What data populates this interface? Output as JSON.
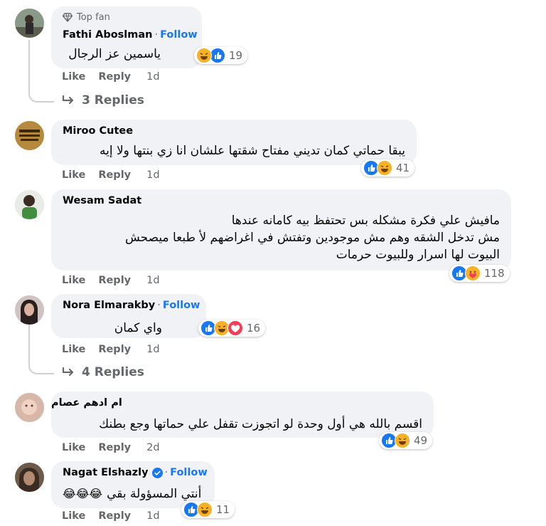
{
  "comments": [
    {
      "badge": "Top fan",
      "author": "Fathi Aboslman",
      "follow": "Follow",
      "text": "ياسمين عز الرجال",
      "reactions": [
        "haha",
        "like"
      ],
      "count": "19",
      "like": "Like",
      "reply": "Reply",
      "time": "1d",
      "replies": "3 Replies"
    },
    {
      "author": "Miroo Cutee",
      "text": "يبقا حماتي كمان تديني مفتاح شقتها علشان انا زي بنتها ولا إيه",
      "reactions": [
        "like",
        "haha"
      ],
      "count": "41",
      "like": "Like",
      "reply": "Reply",
      "time": "1d"
    },
    {
      "author": "Wesam Sadat",
      "lines": [
        "مافيش علي فكرة مشكله بس تحتفظ بيه كامانه عندها",
        "مش تدخل الشقه وهم مش موجودين وتفتش في اغراضهم لأ طبعا ميصحش",
        "البيوت لها اسرار وللبيوت حرمات"
      ],
      "reactions": [
        "like",
        "care"
      ],
      "count": "118",
      "like": "Like",
      "reply": "Reply",
      "time": "1d"
    },
    {
      "author": "Nora Elmarakby",
      "follow": "Follow",
      "text": "واي كمان",
      "reactions": [
        "like",
        "haha",
        "love"
      ],
      "count": "16",
      "like": "Like",
      "reply": "Reply",
      "time": "1d",
      "replies": "4 Replies"
    },
    {
      "author": "ام ادهم عصام",
      "text": "اقسم بالله هي أول وحدة لو اتجوزت تقفل علي حماتها وجع بطنك",
      "reactions": [
        "like",
        "haha"
      ],
      "count": "49",
      "like": "Like",
      "reply": "Reply",
      "time": "2d"
    },
    {
      "author": "Nagat Elshazly",
      "follow": "Follow",
      "text": "أنتي المسؤولة بقي",
      "emoji_glyphs": "😂😂😂",
      "reactions": [
        "like",
        "haha"
      ],
      "count": "11",
      "like": "Like",
      "reply": "Reply",
      "time": "1d"
    }
  ],
  "colors": {
    "bubble": "#f0f2f5",
    "link": "#1877f2",
    "meta": "#65676b",
    "like_blue": "#1877f2",
    "haha_yellow": "#f7b125",
    "love_red": "#f33e58"
  }
}
